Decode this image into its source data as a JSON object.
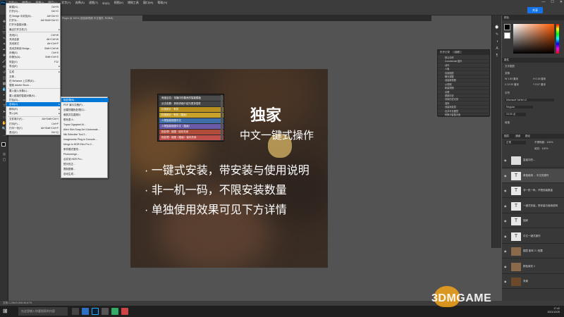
{
  "app": {
    "name": "Ps",
    "menus": [
      "文件(F)",
      "编辑(E)",
      "图像(I)",
      "图层(L)",
      "文字(Y)",
      "选择(S)",
      "滤镜(T)",
      "3D(D)",
      "视图(V)",
      "增效工具",
      "窗口(W)",
      "帮助(H)"
    ],
    "window_controls": [
      "—",
      "☐",
      "✕"
    ],
    "share_label": "共享"
  },
  "tabs": [
    {
      "label": "未标题-1 @ 66.7% (RGB/8#)"
    },
    {
      "label": "Plugin @ 100% (准独家视频 中文插件, RGB/8)"
    }
  ],
  "file_menu": {
    "items": [
      {
        "label": "新建(N)...",
        "shortcut": "Ctrl+N"
      },
      {
        "label": "打开(O)...",
        "shortcut": "Ctrl+O"
      },
      {
        "label": "在 Bridge 中浏览(B)...",
        "shortcut": "Alt+Ctrl+O"
      },
      {
        "label": "打开为...",
        "shortcut": "Alt+Shift+Ctrl+O"
      },
      {
        "label": "打开为智能对象...",
        "shortcut": ""
      },
      {
        "label": "最近打开文件(T)",
        "shortcut": ""
      },
      {
        "label": "关闭(C)",
        "shortcut": "Ctrl+W"
      },
      {
        "label": "关闭全部",
        "shortcut": "Alt+Ctrl+W"
      },
      {
        "label": "关闭其它",
        "shortcut": "Alt+Ctrl+P"
      },
      {
        "label": "关闭并转到 Bridge...",
        "shortcut": "Shift+Ctrl+W"
      },
      {
        "label": "存储(S)",
        "shortcut": "Ctrl+S"
      },
      {
        "label": "存储为(A)...",
        "shortcut": "Shift+Ctrl+S"
      },
      {
        "label": "恢复(V)",
        "shortcut": "F12"
      },
      {
        "label": "导出(E)",
        "shortcut": ""
      },
      {
        "label": "生成",
        "shortcut": ""
      },
      {
        "label": "共享...",
        "shortcut": ""
      },
      {
        "label": "在 Behance 上共享(D)...",
        "shortcut": ""
      },
      {
        "label": "搜索 Adobe Stock...",
        "shortcut": ""
      },
      {
        "label": "置入嵌入对象(L)...",
        "shortcut": ""
      },
      {
        "label": "置入链接的智能对象(K)...",
        "shortcut": ""
      },
      {
        "label": "打包(G)...",
        "shortcut": ""
      },
      {
        "label": "自动(U)",
        "shortcut": ""
      },
      {
        "label": "脚本(R)",
        "shortcut": ""
      },
      {
        "label": "导入(M)",
        "shortcut": ""
      },
      {
        "label": "文件简介(F)...",
        "shortcut": "Alt+Shift+Ctrl+I"
      },
      {
        "label": "打印(P)...",
        "shortcut": "Ctrl+P"
      },
      {
        "label": "打印一份(Y)",
        "shortcut": "Alt+Shift+Ctrl+P"
      },
      {
        "label": "退出(X)",
        "shortcut": "Ctrl+Q"
      }
    ]
  },
  "submenu": {
    "items": [
      "批处理(B)...",
      "PDF 演示文稿(P)...",
      "创建快捷批处理(C)...",
      "裁剪并拉直照片",
      "联系表 II...",
      "Topaz Gigapixel AI...",
      "Alien Skin Snap Art 4 Automate...",
      "Nik Selective Tool 2...",
      "Imagenomic Plug-in Console...",
      "Merge to HDR Efex Pro 2...",
      "条件模式更改...",
      "Photomerge...",
      "合并到 HDR Pro...",
      "镜头校正...",
      "限制图像...",
      "自动生成..."
    ]
  },
  "canvas": {
    "context_panel": [
      {
        "label": "淘宝店名：传播中的善良的智能模板",
        "color": "#4a4a4a"
      },
      {
        "label": "点击查看：其他详细介绍与更多插件",
        "color": "#444"
      },
      {
        "label": "抖音统计 · 有效",
        "color": "#b8901f"
      },
      {
        "label": "抖音统计 · 有效（插画）",
        "color": "#c9a22a"
      },
      {
        "label": "人物智能抠图中文",
        "color": "#3f6fa8"
      },
      {
        "label": "人物智能抠图中文（插画）",
        "color": "#6a5aa8"
      },
      {
        "label": "批处理：抠图 · 保存关闭",
        "color": "#b04c3a"
      },
      {
        "label": "批处理：抠图（插画）· 保存关闭",
        "color": "#c2504a"
      }
    ],
    "headline": "独家",
    "subheadline": "中文一键式操作",
    "bullets": [
      "· 一键式安装，带安装与使用说明",
      "· 非一机一码，不限安装数量",
      "· 单独使用效果可见下方详情"
    ]
  },
  "history_panel": {
    "tabs": [
      "历史记录",
      "动作"
    ],
    "rows": [
      "默认动作",
      "Commercial 插件",
      "动作",
      "人像",
      "应用图层",
      "曝光调整",
      "创建新快照",
      "从快照",
      "新建快照",
      "清理",
      "更新历史",
      "清除历史记录",
      "选择",
      "创建渐变层",
      "合并可见图层",
      "转换为智能对象"
    ]
  },
  "right_panel": {
    "color_title": "颜色",
    "swatches_title": "色板",
    "properties_title": "属性",
    "properties_items": [
      "文字图层",
      "变换",
      "W 1.83 厘米",
      "H 0.18 厘米",
      "X 12.00 厘米",
      "Y 0.67 厘米",
      "字符",
      "Microsoft YaHei UI",
      "Regular",
      "24.00 点",
      "段落"
    ],
    "layers_title": "图层",
    "layers_tabs": [
      "通道",
      "路径"
    ],
    "blend_mode": "正常",
    "opacity": "不透明度：100%",
    "fill": "填充：100%",
    "layers": [
      {
        "name": "复者中的...",
        "type": "image"
      },
      {
        "name": "单独使用 ... 中文的操作",
        "type": "text"
      },
      {
        "name": "非一机一码，不限安装数量",
        "type": "text"
      },
      {
        "name": "一键式安装，带安装与使用说明",
        "type": "text"
      },
      {
        "name": "独家",
        "type": "text"
      },
      {
        "name": "中文一键式操作",
        "type": "text"
      },
      {
        "name": "图层 副本 2 / 效果",
        "type": "image"
      },
      {
        "name": "颜色填充 1",
        "type": "image"
      },
      {
        "name": "背景",
        "type": "image"
      }
    ]
  },
  "status": {
    "text": "文档:1.23M/3.00M  66.67%"
  },
  "taskbar": {
    "search_placeholder": "在这里输入你要搜索的内容",
    "time": "17:42",
    "date": "2021/12/25"
  },
  "watermark": "3DMGAME",
  "colors": {
    "accent": "#0078d7",
    "share": "#1473e6",
    "panel_bg": "#383838"
  }
}
